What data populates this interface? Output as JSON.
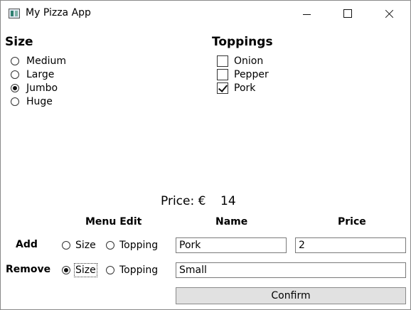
{
  "window": {
    "title": "My Pizza App",
    "icon": "window-app-icon",
    "controls": [
      "minimize-icon",
      "maximize-icon",
      "close-icon"
    ]
  },
  "size": {
    "heading": "Size",
    "options": [
      {
        "label": "Medium",
        "checked": false
      },
      {
        "label": "Large",
        "checked": false
      },
      {
        "label": "Jumbo",
        "checked": true
      },
      {
        "label": "Huge",
        "checked": false
      }
    ]
  },
  "toppings": {
    "heading": "Toppings",
    "options": [
      {
        "label": "Onion",
        "checked": false
      },
      {
        "label": "Pepper",
        "checked": false
      },
      {
        "label": "Pork",
        "checked": true
      }
    ]
  },
  "price": {
    "label": "Price: €",
    "value": "14"
  },
  "menu_edit": {
    "headers": {
      "menu_edit": "Menu Edit",
      "name": "Name",
      "price": "Price"
    },
    "add": {
      "label": "Add",
      "size_option": "Size",
      "topping_option": "Topping",
      "selected": "none",
      "name_value": "Pork",
      "price_value": "2"
    },
    "remove": {
      "label": "Remove",
      "size_option": "Size",
      "topping_option": "Topping",
      "selected": "Size",
      "name_value": "Small"
    },
    "confirm_label": "Confirm"
  }
}
